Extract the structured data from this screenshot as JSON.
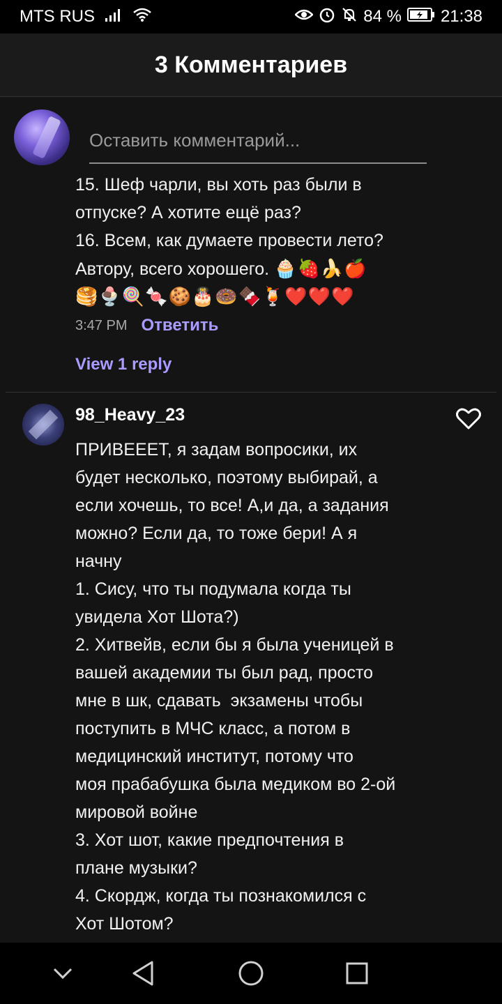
{
  "status_bar": {
    "carrier": "MTS RUS",
    "battery": "84 %",
    "time": "21:38"
  },
  "header": {
    "title": "3 Комментариев"
  },
  "compose": {
    "placeholder": "Оставить комментарий..."
  },
  "previous_comment": {
    "text": "15. Шеф чарли, вы хоть раз были в\nотпуске? А хотите ещё раз?\n16. Всем, как думаете провести лето?\nАвтору, всего хорошего. ",
    "emoji_line1": "🧁🍓🍌🍎",
    "emoji_line2": "🥞🍨🍭🍬🍪🎂🍩🍫🍹❤️❤️❤️",
    "time": "3:47 PM",
    "reply_label": "Ответить",
    "view_replies_label": "View 1 reply"
  },
  "comment": {
    "username": "98_Heavy_23",
    "text": "ПРИВЕЕЕТ, я задам вопросики, их\nбудет несколько, поэтому выбирай, а\nесли хочешь, то все! А,и да, а задания\nможно? Если да, то тоже бери! А я\nначну\n1. Сису, что ты подумала когда ты\nувидела Хот Шота?)\n2. Хитвейв, если бы я была ученицей в\nвашей академии ты был рад, просто\nмне в шк, сдавать  экзамены чтобы\nпоступить в МЧС класс, а потом в\nмедицинский институт, потому что\nмоя прабабушка была медиком во 2-ой\nмировой войне\n3. Хот шот, какие предпочтения в\nплане музыки?\n4. Скордж, когда ты познакомился с\nХот Шотом?"
  },
  "colors": {
    "accent": "#a89cff",
    "header_bg": "#1b1b1b",
    "content_bg": "#141414"
  }
}
